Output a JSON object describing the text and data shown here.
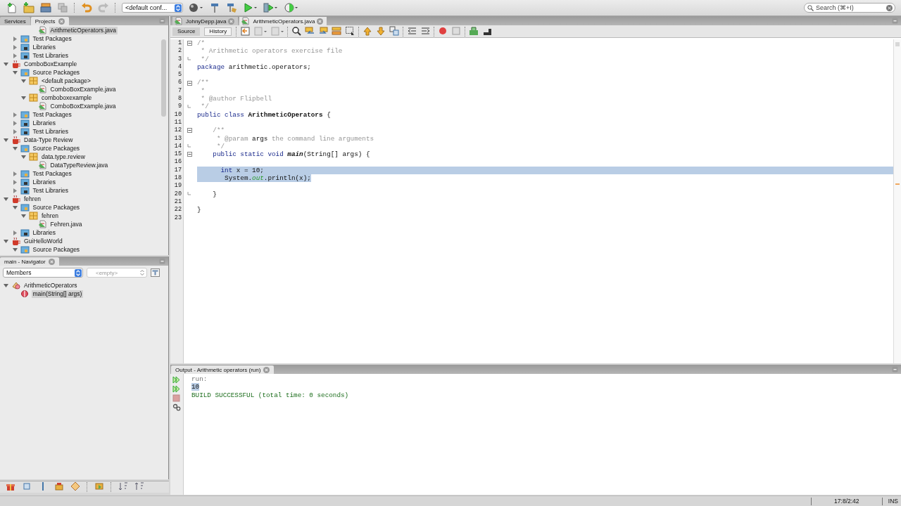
{
  "toolbar": {
    "config": "<default conf...",
    "search": {
      "placeholder": "Search (⌘+I)"
    }
  },
  "projects": {
    "tabs": [
      {
        "label": "Services",
        "selected": false,
        "closable": false
      },
      {
        "label": "Projects",
        "selected": true,
        "closable": true
      }
    ],
    "tree": [
      {
        "children": [
          {
            "children": [
              {
                "children": [
                  {
                    "kind": "file",
                    "label": "ArithmeticOperators.java",
                    "selected": true
                  }
                ]
              }
            ]
          },
          {
            "kind": "folder",
            "label": "Test Packages",
            "expanded": false,
            "selected": false
          },
          {
            "kind": "library",
            "label": "Libraries",
            "expanded": false,
            "selected": false
          },
          {
            "kind": "library",
            "label": "Test Libraries",
            "expanded": false,
            "selected": false
          }
        ]
      },
      {
        "kind": "project",
        "label": "ComboBoxExample",
        "expanded": true,
        "selected": false,
        "children": [
          {
            "kind": "folder",
            "label": "Source Packages",
            "expanded": true,
            "selected": false,
            "children": [
              {
                "kind": "package",
                "label": "<default package>",
                "expanded": true,
                "selected": false,
                "children": [
                  {
                    "kind": "file",
                    "label": "ComboBoxExample.java",
                    "selected": false
                  }
                ]
              },
              {
                "kind": "package",
                "label": "comboboxexample",
                "expanded": true,
                "selected": false,
                "children": [
                  {
                    "kind": "file",
                    "label": "ComboBoxExample.java",
                    "selected": false
                  }
                ]
              }
            ]
          },
          {
            "kind": "folder",
            "label": "Test Packages",
            "expanded": false,
            "selected": false
          },
          {
            "kind": "library",
            "label": "Libraries",
            "expanded": false,
            "selected": false
          },
          {
            "kind": "library",
            "label": "Test Libraries",
            "expanded": false,
            "selected": false
          }
        ]
      },
      {
        "kind": "project",
        "label": "Data-Type Review",
        "expanded": true,
        "selected": false,
        "children": [
          {
            "kind": "folder",
            "label": "Source Packages",
            "expanded": true,
            "selected": false,
            "children": [
              {
                "kind": "package",
                "label": "data.type.review",
                "expanded": true,
                "selected": false,
                "children": [
                  {
                    "kind": "file",
                    "label": "DataTypeReview.java",
                    "selected": false
                  }
                ]
              }
            ]
          },
          {
            "kind": "folder",
            "label": "Test Packages",
            "expanded": false,
            "selected": false
          },
          {
            "kind": "library",
            "label": "Libraries",
            "expanded": false,
            "selected": false
          },
          {
            "kind": "library",
            "label": "Test Libraries",
            "expanded": false,
            "selected": false
          }
        ]
      },
      {
        "kind": "project",
        "label": "fehren",
        "expanded": true,
        "selected": false,
        "children": [
          {
            "kind": "folder",
            "label": "Source Packages",
            "expanded": true,
            "selected": false,
            "children": [
              {
                "kind": "package",
                "label": "fehren",
                "expanded": true,
                "selected": false,
                "children": [
                  {
                    "kind": "file",
                    "label": "Fehren.java",
                    "selected": false
                  }
                ]
              }
            ]
          },
          {
            "kind": "library",
            "label": "Libraries",
            "expanded": false,
            "selected": false
          }
        ]
      },
      {
        "kind": "project",
        "label": "GuiHelloWorld",
        "expanded": true,
        "selected": false,
        "children": [
          {
            "kind": "folder",
            "label": "Source Packages",
            "expanded": true,
            "selected": false
          }
        ]
      }
    ]
  },
  "navigator": {
    "title": "main - Navigator",
    "filter": "Members",
    "secondary": {
      "placeholder": "<empty>"
    },
    "tree": [
      {
        "kind": "class",
        "label": "ArithmeticOperators",
        "expanded": true,
        "selected": false,
        "children": [
          {
            "kind": "method",
            "label": "main(String[] args)",
            "selected": true
          }
        ]
      }
    ]
  },
  "editor": {
    "tabs": [
      {
        "label": "JohnyDepp.java",
        "selected": false
      },
      {
        "label": "ArithmeticOperators.java",
        "selected": true
      }
    ],
    "views": [
      {
        "label": "Source",
        "selected": true
      },
      {
        "label": "History",
        "selected": false
      }
    ],
    "lines": [
      {
        "number": "1",
        "fold_start": true,
        "selected": false,
        "tokens": [
          {
            "kind": "comment",
            "text": "/*"
          }
        ]
      },
      {
        "number": "2",
        "selected": false,
        "tokens": [
          {
            "kind": "comment",
            "text": " * Arithmetic operators exercise file"
          }
        ]
      },
      {
        "number": "3",
        "fold_end": true,
        "selected": false,
        "tokens": [
          {
            "kind": "comment",
            "text": " */"
          }
        ]
      },
      {
        "number": "4",
        "selected": false,
        "tokens": [
          {
            "kind": "keyword",
            "text": "package"
          },
          {
            "kind": "plain",
            "text": " arithmetic.operators;"
          }
        ]
      },
      {
        "number": "5",
        "selected": false
      },
      {
        "number": "6",
        "fold_start": true,
        "selected": false,
        "tokens": [
          {
            "kind": "comment",
            "text": "/**"
          }
        ]
      },
      {
        "number": "7",
        "selected": false,
        "tokens": [
          {
            "kind": "comment",
            "text": " *"
          }
        ]
      },
      {
        "number": "8",
        "selected": false,
        "tokens": [
          {
            "kind": "comment",
            "text": " * @author Flipbell"
          }
        ]
      },
      {
        "number": "9",
        "fold_end": true,
        "selected": false,
        "tokens": [
          {
            "kind": "comment",
            "text": " */"
          }
        ]
      },
      {
        "number": "10",
        "selected": false,
        "tokens": [
          {
            "kind": "keyword",
            "text": "public class "
          },
          {
            "kind": "type",
            "text": "ArithmeticOperators"
          },
          {
            "kind": "plain",
            "text": " {"
          }
        ]
      },
      {
        "number": "11",
        "selected": false
      },
      {
        "number": "12",
        "fold_start": true,
        "selected": false,
        "tokens": [
          {
            "kind": "comment",
            "text": "    /**"
          }
        ]
      },
      {
        "number": "13",
        "selected": false,
        "tokens": [
          {
            "kind": "comment",
            "text": "     * @param "
          },
          {
            "kind": "plain",
            "text": "args"
          },
          {
            "kind": "comment",
            "text": " the command line arguments"
          }
        ]
      },
      {
        "number": "14",
        "fold_end": true,
        "selected": false,
        "tokens": [
          {
            "kind": "comment",
            "text": "     */"
          }
        ]
      },
      {
        "number": "15",
        "fold_start": true,
        "selected": false,
        "tokens": [
          {
            "kind": "keyword",
            "text": "    public static void "
          },
          {
            "kind": "method",
            "text": "main"
          },
          {
            "kind": "plain",
            "text": "(String[] args) {"
          }
        ]
      },
      {
        "number": "16",
        "selected": false
      },
      {
        "number": "17",
        "selected": true,
        "tokens": [
          {
            "kind": "keyword",
            "text": "      int"
          },
          {
            "kind": "plain",
            "text": " x = 10;"
          }
        ]
      },
      {
        "number": "18",
        "selected": true,
        "tokens": [
          {
            "kind": "plain",
            "text": "       System."
          },
          {
            "kind": "field",
            "text": "out"
          },
          {
            "kind": "plain",
            "text": ".println(x);"
          }
        ]
      },
      {
        "number": "19",
        "selected": false
      },
      {
        "number": "20",
        "fold_end": true,
        "selected": false,
        "tokens": [
          {
            "kind": "plain",
            "text": "    }"
          }
        ]
      },
      {
        "number": "21",
        "selected": false
      },
      {
        "number": "22",
        "selected": false,
        "tokens": [
          {
            "kind": "plain",
            "text": "}"
          }
        ]
      },
      {
        "number": "23",
        "selected": false
      }
    ]
  },
  "output": {
    "title": "Output - Arithmetic operators (run)",
    "lines": [
      {
        "kind": "info",
        "text": "run:",
        "selected": false
      },
      {
        "kind": "plain",
        "text": "10",
        "selected": true
      },
      {
        "kind": "success",
        "text": "BUILD SUCCESSFUL (total time: 0 seconds)",
        "selected": false
      }
    ]
  },
  "status_bar": {
    "position": "17:8/2:42",
    "mode": "INS"
  }
}
